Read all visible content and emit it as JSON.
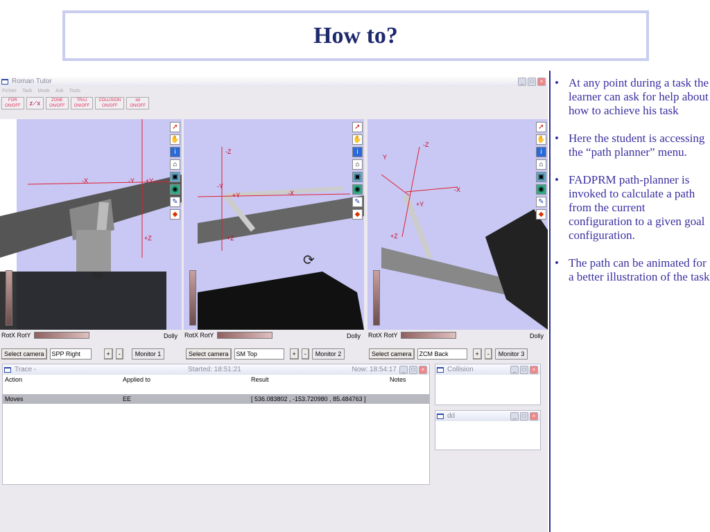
{
  "slide": {
    "title": "How to?"
  },
  "app": {
    "title": "Roman Tutor",
    "menu": [
      "Fichier",
      "Task",
      "Mode",
      "Ask",
      "Tools"
    ],
    "toolbar": [
      {
        "label": "FOR",
        "sub": "ON/OFF"
      },
      {
        "label": "axes",
        "sub": ""
      },
      {
        "label": "ZONE",
        "sub": "ON/OFF"
      },
      {
        "label": "TRAJ",
        "sub": "ON/OFF"
      },
      {
        "label": "COLLISION",
        "sub": "ON/OFF"
      },
      {
        "label": "dd",
        "sub": "ON/OFF"
      }
    ],
    "viewports": [
      {
        "rot_label": "RotX RotY",
        "dolly": "Dolly",
        "select": "Select camera",
        "camera": "SPP Right",
        "plus": "+",
        "minus": "-",
        "monitor": "Monitor 1",
        "axes": [
          "-X",
          "-Y",
          "+Y",
          "+Z"
        ]
      },
      {
        "rot_label": "RotX RotY",
        "dolly": "Dolly",
        "select": "Select camera",
        "camera": "SM Top",
        "plus": "+",
        "minus": "-",
        "monitor": "Monitor 2",
        "axes": [
          "-Z",
          "-Y",
          "+Y",
          "-X",
          "+Z"
        ]
      },
      {
        "rot_label": "RotX RotY",
        "dolly": "Dolly",
        "select": "Select camera",
        "camera": "ZCM Back",
        "plus": "+",
        "minus": "-",
        "monitor": "Monitor 3",
        "axes": [
          "Y",
          "-Z",
          "-X",
          "+Y",
          "+Z"
        ]
      }
    ],
    "trace": {
      "title": "Trace -",
      "started": "Started: 18:51:21",
      "now": "Now: 18:54:17",
      "columns": [
        "Action",
        "Applied to",
        "Result",
        "Notes"
      ],
      "rows": [
        [
          "Moves",
          "EE",
          "[ 536.083802 , -153.720980 , 85.484763 ]",
          ""
        ]
      ]
    },
    "collision": {
      "title": "Collision"
    },
    "dd": {
      "title": "dd"
    }
  },
  "bullets": [
    "At any point during a task the learner can ask for help about how to achieve his task",
    "Here the student is accessing the “path planner” menu.",
    "FADPRM path-planner is invoked to calculate a path from the current configuration to a given goal configuration.",
    "The path can be animated for a better illustration of the task"
  ]
}
